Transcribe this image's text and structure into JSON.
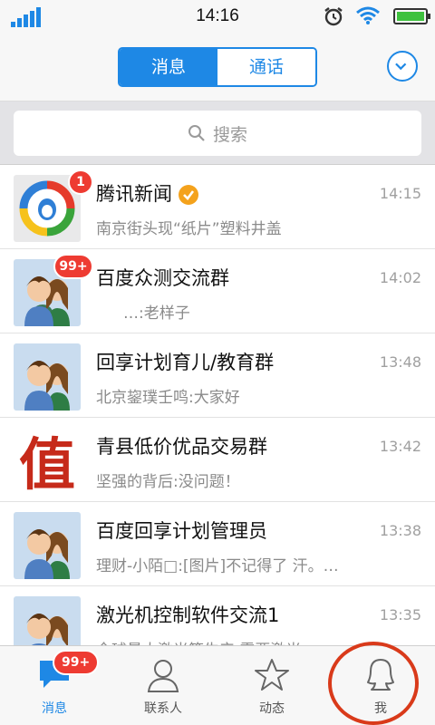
{
  "status_bar": {
    "time": "14:16",
    "icons": [
      "signal-icon",
      "alarm-icon",
      "wifi-icon",
      "battery-icon"
    ]
  },
  "header": {
    "tabs": [
      {
        "label": "消息",
        "active": true
      },
      {
        "label": "通话",
        "active": false
      }
    ],
    "more_icon": "chevron-down-circle-icon"
  },
  "search": {
    "placeholder": "搜索",
    "icon": "search-icon"
  },
  "conversations": [
    {
      "name": "腾讯新闻",
      "time": "14:15",
      "message": "南京街头现“纸片”塑料井盖",
      "badge": "1",
      "avatar": "tencent-news-logo",
      "verified": true
    },
    {
      "name": "百度众测交流群",
      "time": "14:02",
      "message": "…:老样子",
      "badge": "99+",
      "avatar": "group-avatar"
    },
    {
      "name": "回享计划育儿/教育群",
      "time": "13:48",
      "message": "北京鋆璞壬鸣:大家好",
      "badge": "",
      "avatar": "group-avatar"
    },
    {
      "name": "青县低价优品交易群",
      "time": "13:42",
      "message": "坚强的背后:没问题！",
      "badge": "",
      "avatar": "zhi-character-avatar"
    },
    {
      "name": "百度回享计划管理员",
      "time": "13:38",
      "message": "理财-小陌□:[图片]不记得了 汗。…",
      "badge": "",
      "avatar": "group-avatar"
    },
    {
      "name": "激光机控制软件交流1",
      "time": "13:35",
      "message": "全球最大激光等生产 需要激光",
      "badge": "",
      "avatar": "group-avatar"
    }
  ],
  "tabbar": {
    "items": [
      {
        "label": "消息",
        "icon": "chat-bubble-icon",
        "active": true,
        "badge": "99+"
      },
      {
        "label": "联系人",
        "icon": "contact-icon",
        "active": false
      },
      {
        "label": "动态",
        "icon": "star-icon",
        "active": false
      },
      {
        "label": "我",
        "icon": "penguin-icon",
        "active": false
      }
    ]
  },
  "colors": {
    "accent": "#1e88e5",
    "badge": "#ee3b32",
    "annotation_circle": "#d93a1a"
  }
}
